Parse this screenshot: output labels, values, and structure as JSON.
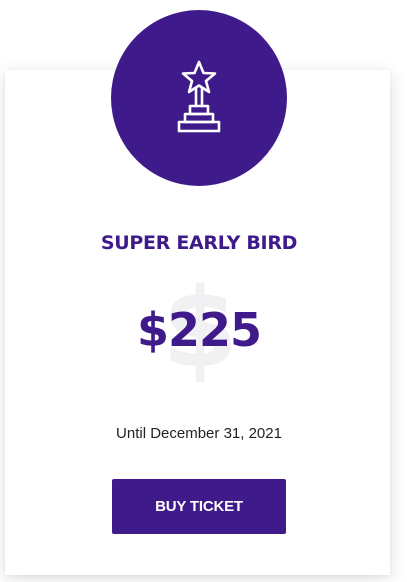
{
  "ticket": {
    "icon": "trophy-star-icon",
    "title": "SUPER EARLY BIRD",
    "price": "$225",
    "watermark_symbol": "$",
    "until": "Until December 31, 2021",
    "button_label": "BUY TICKET"
  },
  "colors": {
    "accent": "#3f1a8a",
    "text": "#222222",
    "watermark": "#f1f1f4",
    "background": "#ffffff"
  }
}
